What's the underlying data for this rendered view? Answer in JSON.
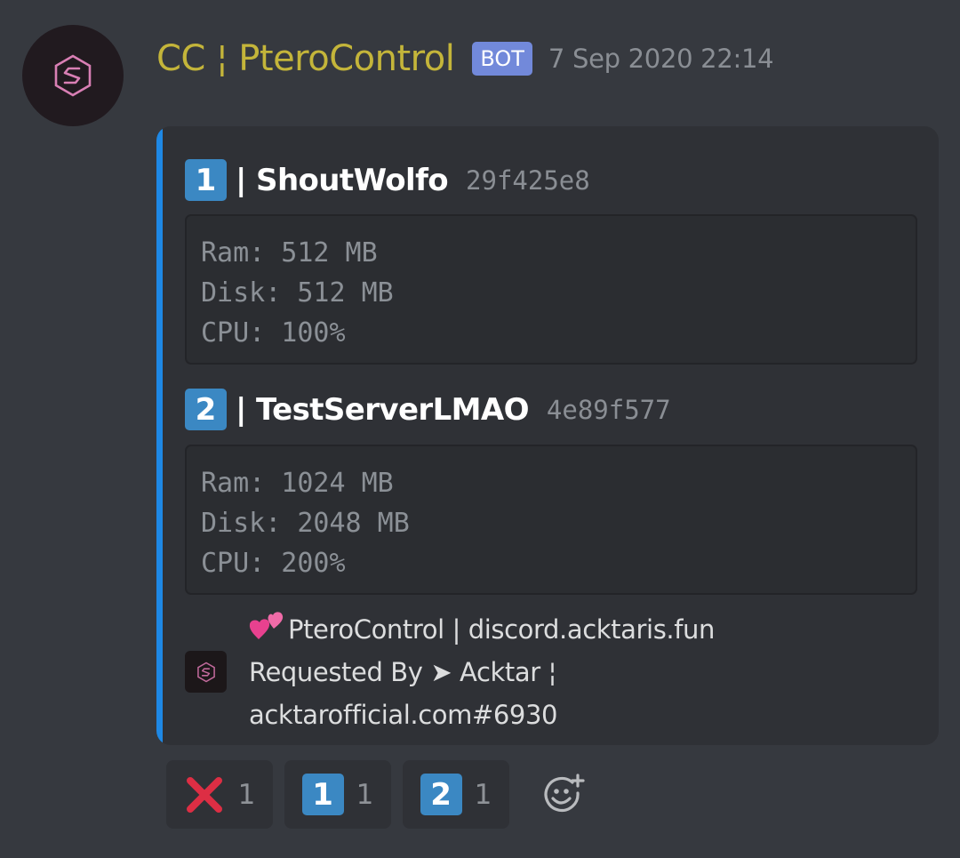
{
  "message": {
    "author": "CC ¦ PteroControl",
    "bot_tag": "BOT",
    "timestamp": "7 Sep 2020 22:14",
    "avatar_icon": "pterocontrol-logo-icon"
  },
  "embed": {
    "accent_color": "#1e88e5",
    "servers": [
      {
        "number": "1",
        "name": "| ShoutWolfo",
        "id": "29f425e8",
        "stats": [
          "Ram: 512 MB",
          "Disk: 512 MB",
          "CPU: 100%"
        ]
      },
      {
        "number": "2",
        "name": "| TestServerLMAO",
        "id": "4e89f577",
        "stats": [
          "Ram: 1024 MB",
          "Disk: 2048 MB",
          "CPU: 200%"
        ]
      }
    ],
    "footer": {
      "icon": "pterocontrol-logo-icon",
      "emoji": "two-hearts-icon",
      "line1": "PteroControl | discord.acktaris.fun",
      "line2": "Requested By ➤ Acktar ¦",
      "line3": "acktarofficial.com#6930"
    }
  },
  "reactions": [
    {
      "emoji": "cross-mark-icon",
      "count": "1"
    },
    {
      "emoji": "keycap-1-icon",
      "label": "1",
      "count": "1"
    },
    {
      "emoji": "keycap-2-icon",
      "label": "2",
      "count": "1"
    }
  ],
  "add_reaction_icon": "add-reaction-icon"
}
